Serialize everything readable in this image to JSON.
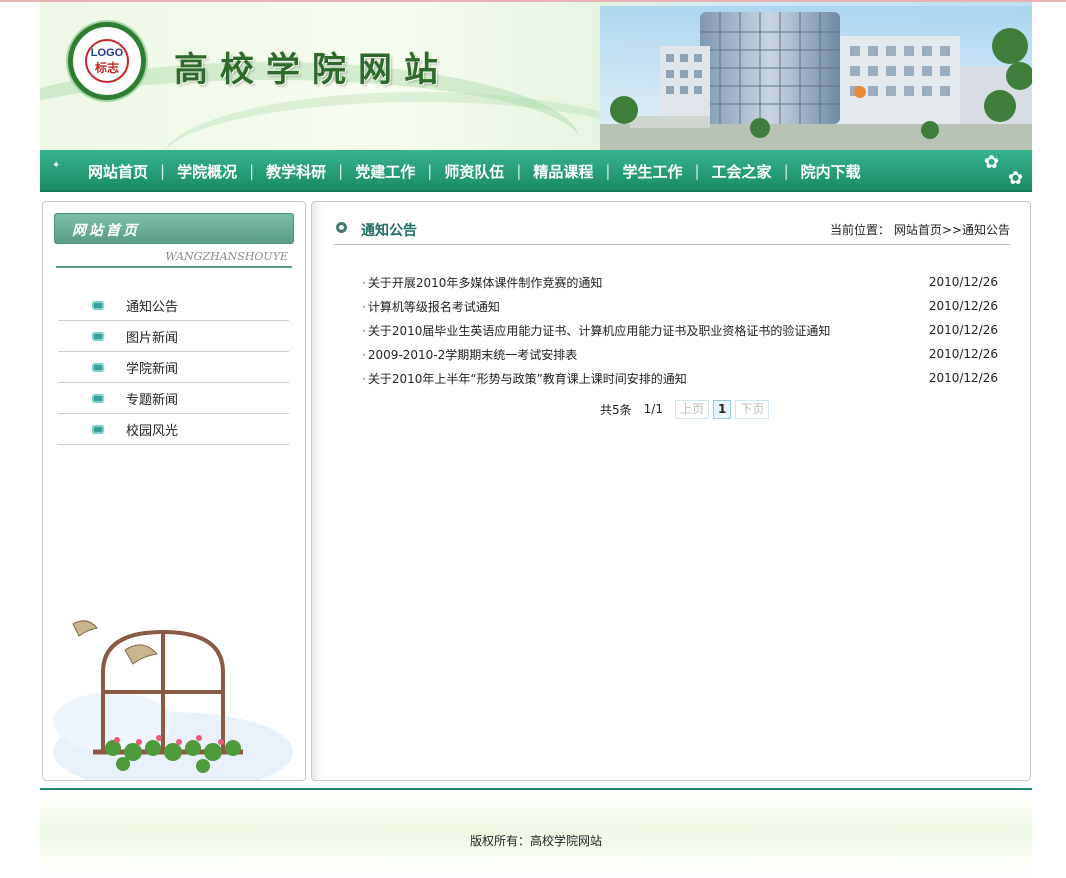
{
  "header": {
    "logo_text_en": "LOGO",
    "logo_text_cn": "标志",
    "site_title": "高校学院网站"
  },
  "nav": {
    "items": [
      {
        "label": "网站首页"
      },
      {
        "label": "学院概况"
      },
      {
        "label": "教学科研"
      },
      {
        "label": "党建工作"
      },
      {
        "label": "师资队伍"
      },
      {
        "label": "精品课程"
      },
      {
        "label": "学生工作"
      },
      {
        "label": "工会之家"
      },
      {
        "label": "院内下载"
      }
    ],
    "separator": "|"
  },
  "sidebar": {
    "heading": "网站首页",
    "subheading": "WANGZHANSHOUYE",
    "items": [
      {
        "label": "通知公告"
      },
      {
        "label": "图片新闻"
      },
      {
        "label": "学院新闻"
      },
      {
        "label": "专题新闻"
      },
      {
        "label": "校园风光"
      }
    ]
  },
  "main": {
    "title": "通知公告",
    "breadcrumb": {
      "prefix": "当前位置：",
      "home": "网站首页",
      "sep": ">>",
      "current": "通知公告"
    },
    "news": [
      {
        "title": "关于开展2010年多媒体课件制作竞赛的通知",
        "date": "2010/12/26"
      },
      {
        "title": "计算机等级报名考试通知",
        "date": "2010/12/26"
      },
      {
        "title": "关于2010届毕业生英语应用能力证书、计算机应用能力证书及职业资格证书的验证通知",
        "date": "2010/12/26"
      },
      {
        "title": "2009-2010-2学期期末统一考试安排表",
        "date": "2010/12/26"
      },
      {
        "title": "关于2010年上半年“形势与政策”教育课上课时间安排的通知",
        "date": "2010/12/26"
      }
    ],
    "pager": {
      "total": "共5条",
      "pages": "1/1",
      "prev": "上页",
      "current": "1",
      "next": "下页"
    }
  },
  "footer": {
    "copyright": "版权所有：高校学院网站"
  },
  "colors": {
    "nav_green": "#1a8c66",
    "title_green": "#2e6b2a",
    "accent_teal": "#1e6e63"
  }
}
